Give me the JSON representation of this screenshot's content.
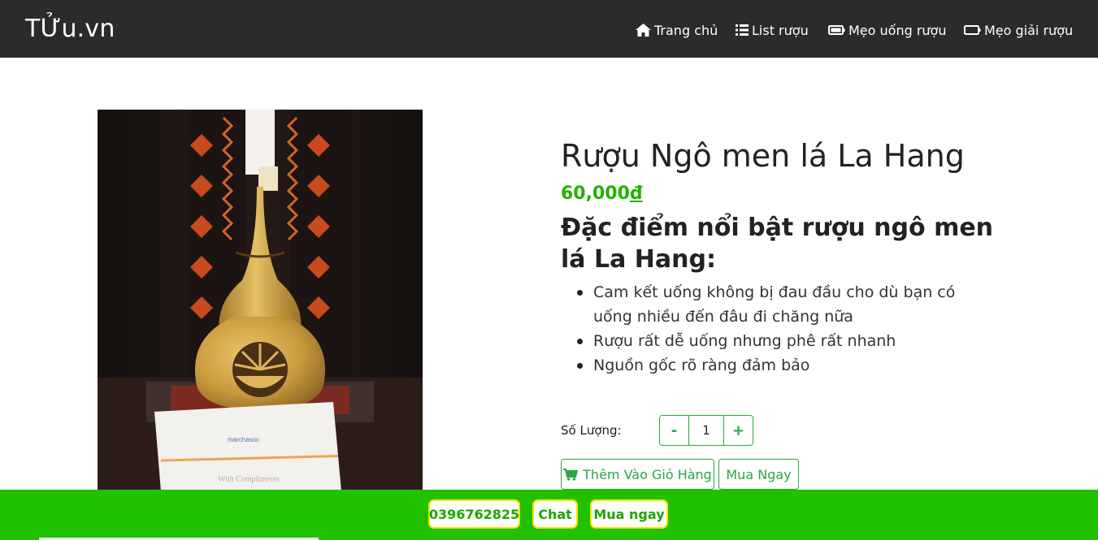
{
  "nav": {
    "brand": "TỬu.vn",
    "items": [
      {
        "label": "Trang chủ",
        "icon": "home-icon"
      },
      {
        "label": "List rượu",
        "icon": "list-icon"
      },
      {
        "label": "Mẹo uống rượu",
        "icon": "battery-full-icon"
      },
      {
        "label": "Mẹo giải rượu",
        "icon": "battery-empty-icon"
      }
    ]
  },
  "product": {
    "title": "Rượu Ngô men lá La Hang",
    "price_value": "60,000",
    "price_currency": "đ",
    "subheading": "Đặc điểm nổi bật rượu ngô men lá La Hang:",
    "features": [
      "Cam kết uống không bị đau đầu cho dù bạn có uống nhiều đến đâu đi chăng nữa",
      "Rượu rất dễ uống nhưng phê rất nhanh",
      "Nguồn gốc rõ ràng đảm bảo"
    ],
    "card_text": "With Compliments"
  },
  "quantity": {
    "label": "Số Lượng:",
    "decrement": "-",
    "value": "1",
    "increment": "+"
  },
  "actions": {
    "add_to_cart": "Thêm Vào Giỏ Hàng",
    "buy_now": "Mua Ngay"
  },
  "bottom_bar": {
    "phone": "0396762825",
    "chat": "Chat",
    "order": "Mua ngay"
  },
  "colors": {
    "navbar": "#2b2b2b",
    "accent_green": "#28a745",
    "price_green": "#22b100",
    "bottom_bar": "#22c100",
    "bottom_button_border": "#f5e600"
  }
}
